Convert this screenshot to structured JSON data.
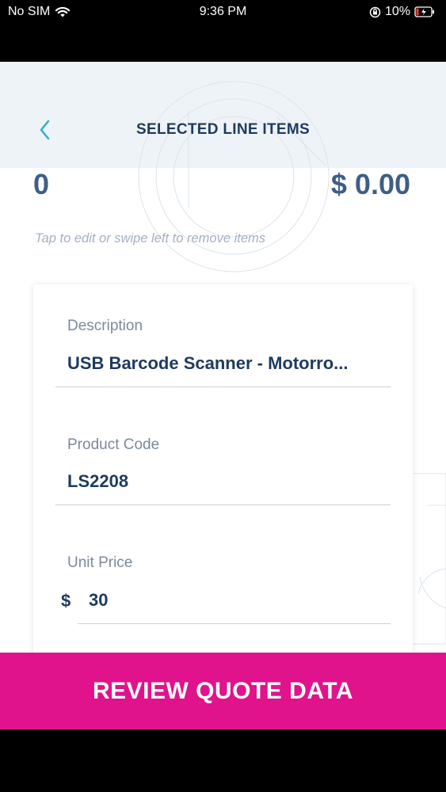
{
  "status_bar": {
    "carrier": "No SIM",
    "time": "9:36 PM",
    "battery": "10%"
  },
  "header": {
    "title": "SELECTED LINE ITEMS",
    "back_icon": "chevron-left-icon"
  },
  "summary": {
    "item_count": "0",
    "total": "$ 0.00"
  },
  "hint": "Tap to edit or swipe left to remove items",
  "line_item": {
    "description_label": "Description",
    "description_value": "USB Barcode Scanner - Motorro...",
    "product_code_label": "Product Code",
    "product_code_value": "LS2208",
    "unit_price_label": "Unit Price",
    "currency_symbol": "$",
    "unit_price_value": "30"
  },
  "footer": {
    "review_button_label": "REVIEW QUOTE DATA"
  },
  "colors": {
    "accent": "#e0138c",
    "primary_text": "#1e3a5f",
    "back_icon": "#2bb3c0"
  }
}
